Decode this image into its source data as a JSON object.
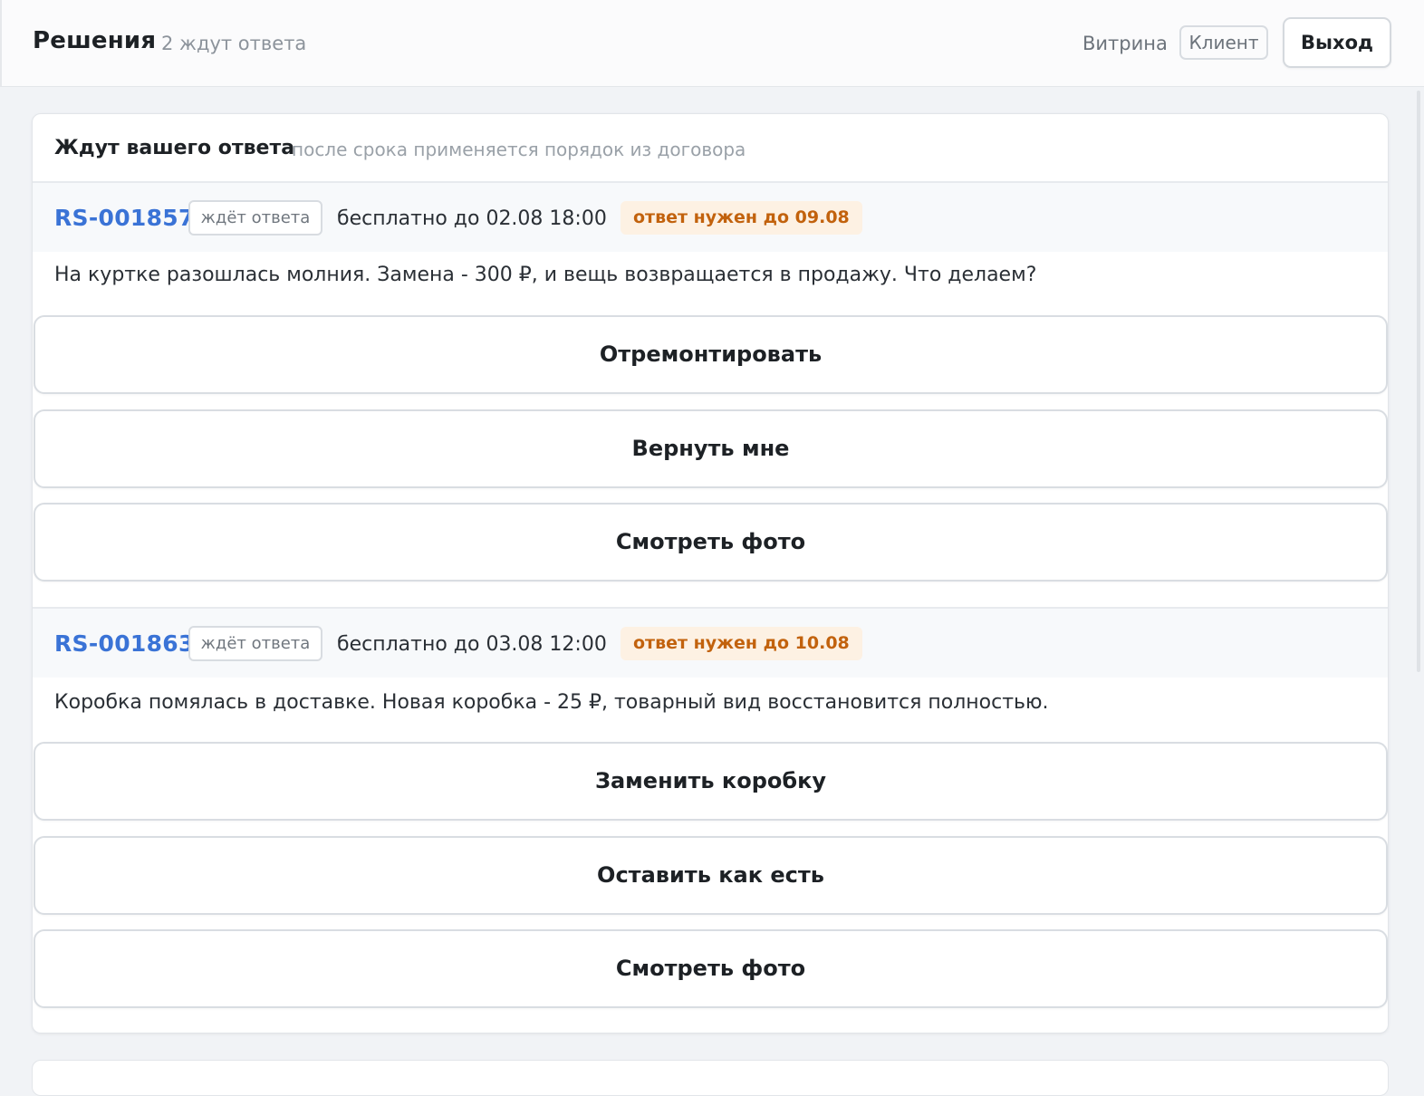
{
  "header": {
    "title": "Решения",
    "subtitle": "2 ждут ответа",
    "store_label": "Витрина",
    "role_badge": "Клиент",
    "logout_label": "Выход"
  },
  "section": {
    "title": "Ждут вашего ответа",
    "note": "после срока применяется порядок из договора"
  },
  "cases": [
    {
      "id": "RS-001857",
      "status": "ждёт ответа",
      "free_until": "бесплатно до 02.08 18:00",
      "deadline": "ответ нужен до 09.08",
      "description": "На куртке разошлась молния. Замена - 300 ₽, и вещь возвращается в продажу. Что делаем?",
      "actions": [
        "Отремонтировать",
        "Вернуть мне",
        "Смотреть фото"
      ]
    },
    {
      "id": "RS-001863",
      "status": "ждёт ответа",
      "free_until": "бесплатно до 03.08 12:00",
      "deadline": "ответ нужен до 10.08",
      "description": "Коробка помялась в доставке. Новая коробка - 25 ₽, товарный вид восстановится полностью.",
      "actions": [
        "Заменить коробку",
        "Оставить как есть",
        "Смотреть фото"
      ]
    }
  ],
  "colors": {
    "accent_link": "#3a73d6",
    "deadline_text": "#c2620d",
    "deadline_bg": "#fdf1e3",
    "page_bg": "#f1f3f6"
  }
}
